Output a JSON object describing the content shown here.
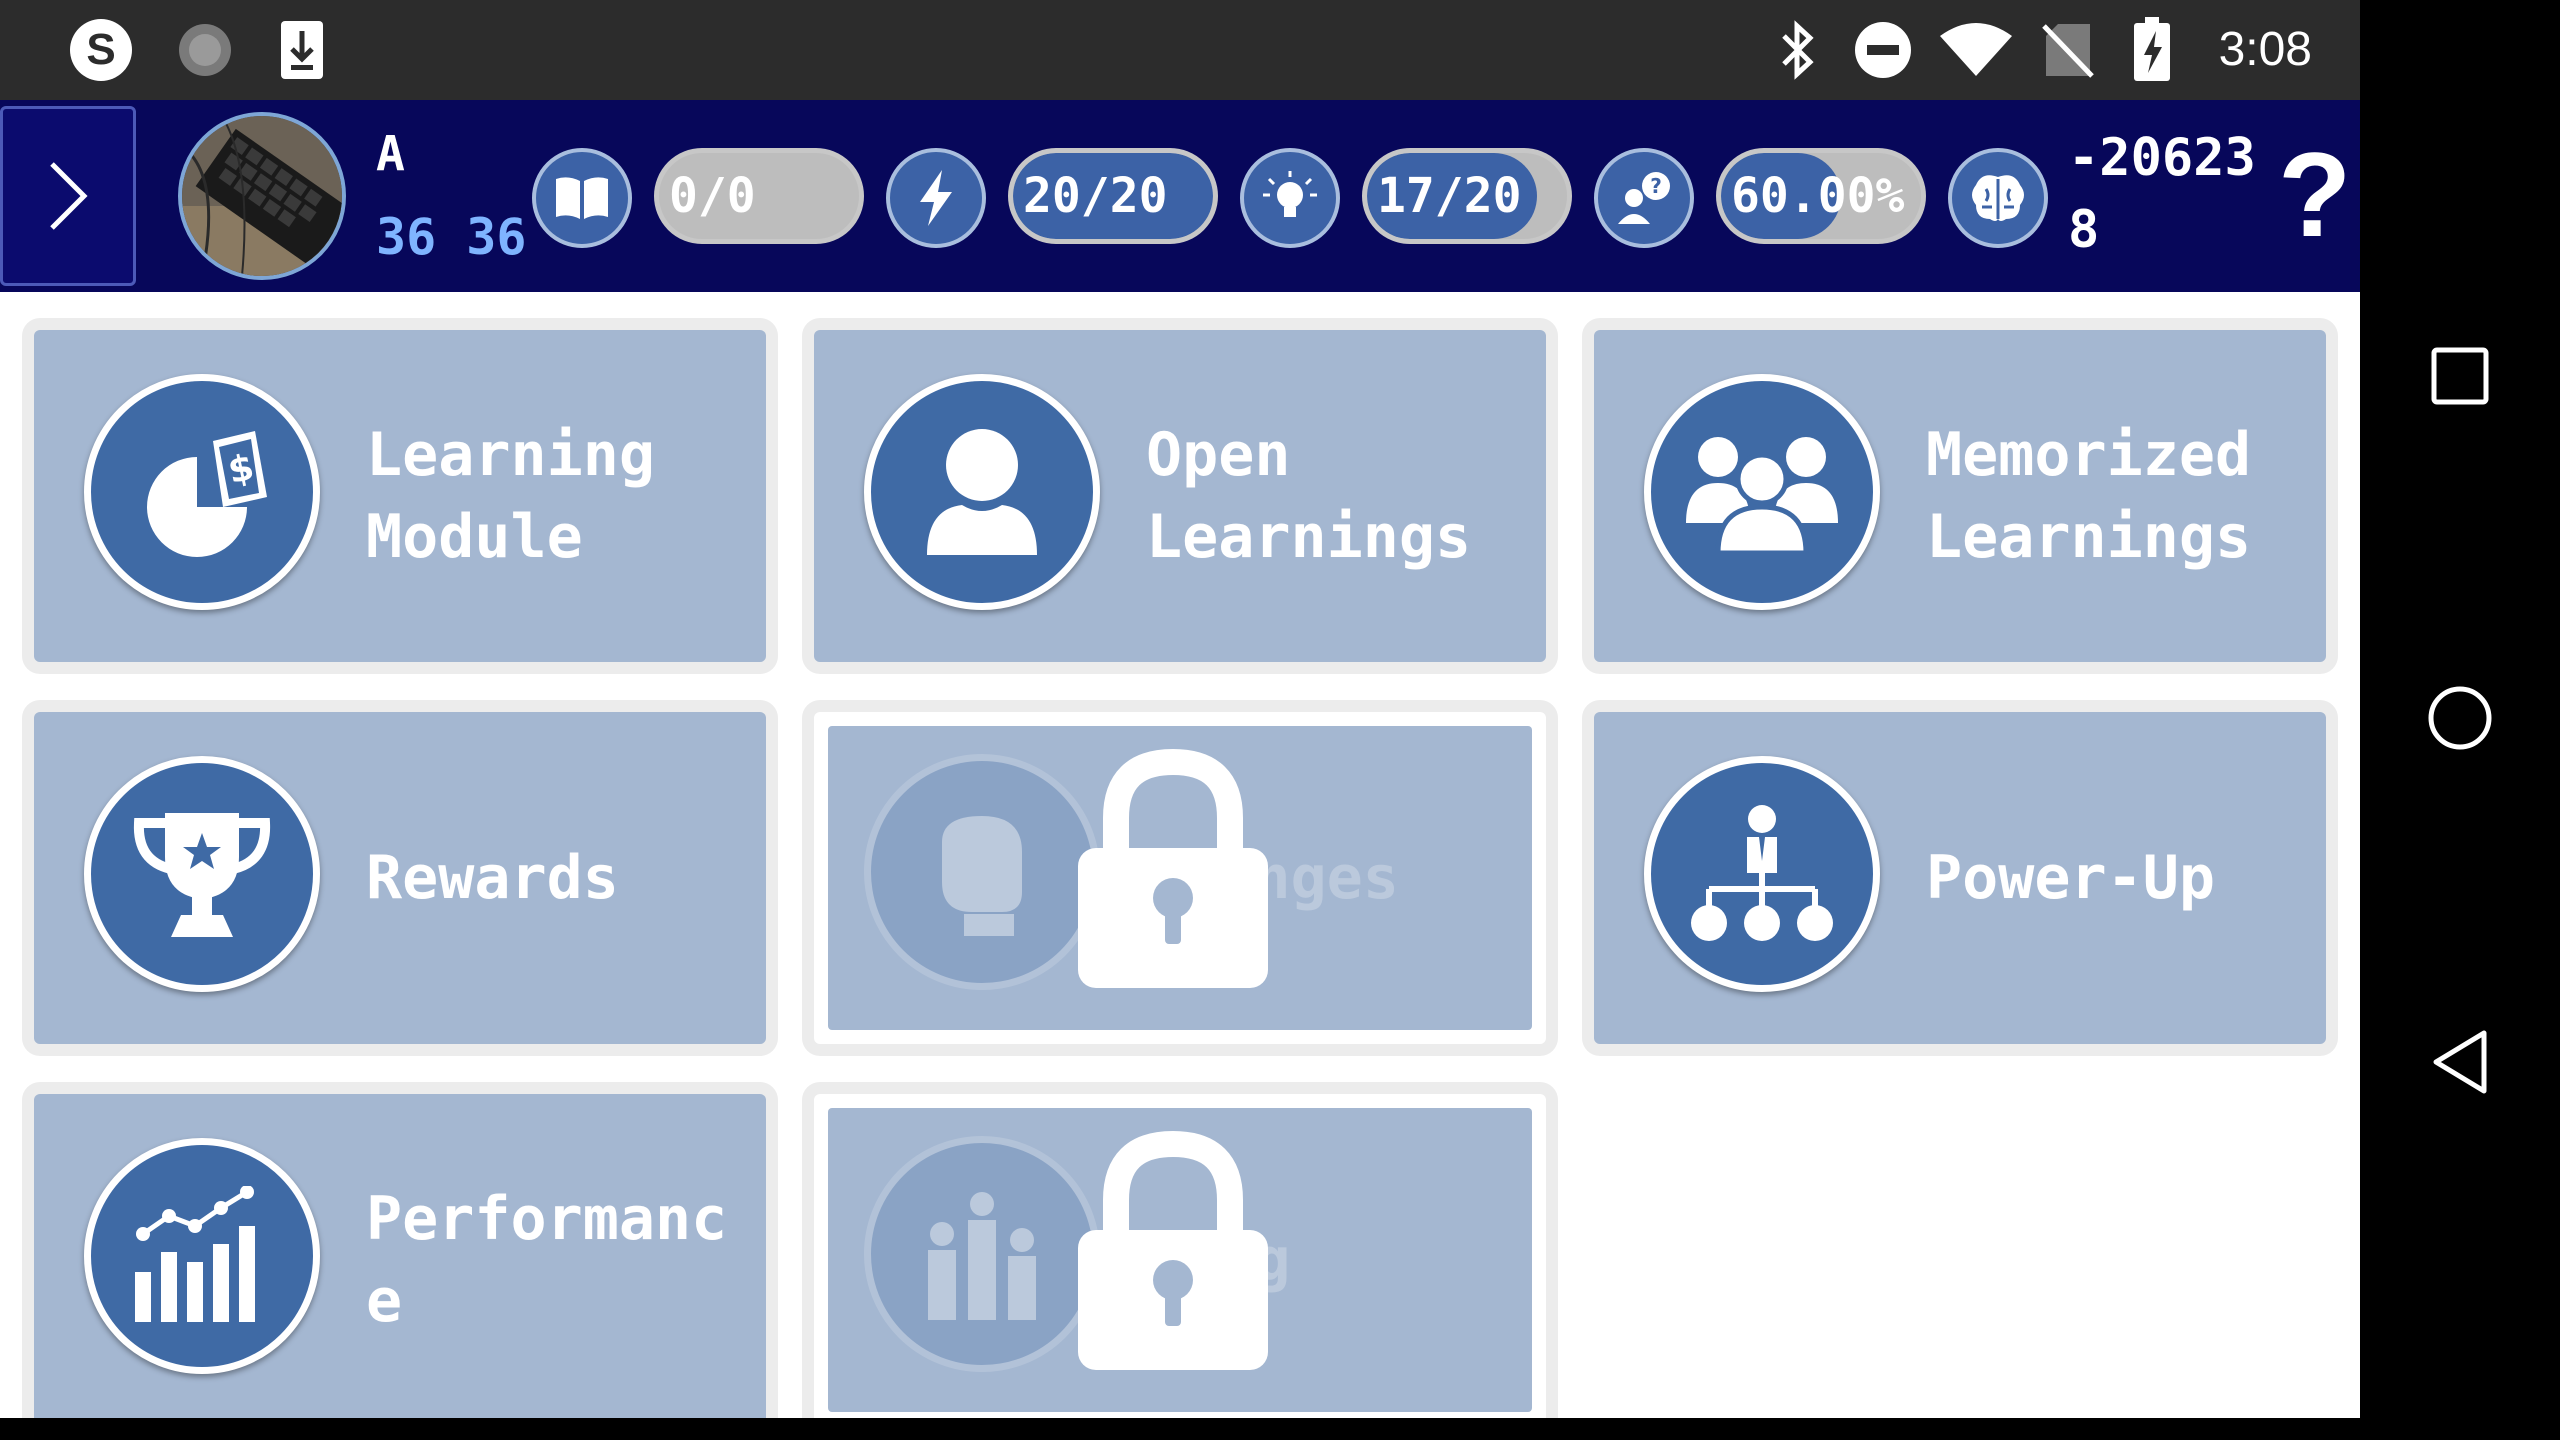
{
  "status_bar": {
    "time": "3:08",
    "left_icons": [
      "skype-icon",
      "loading-icon",
      "download-icon"
    ],
    "right_icons": [
      "bluetooth-icon",
      "do-not-disturb-icon",
      "wifi-icon",
      "no-sim-icon",
      "battery-charging-icon"
    ]
  },
  "header": {
    "user_name": "A",
    "user_level": "36 36",
    "stats": [
      {
        "icon": "book-icon",
        "text": "0/0",
        "fill": 0
      },
      {
        "icon": "lightning-icon",
        "text": "20/20",
        "fill": 1.0
      },
      {
        "icon": "lightbulb-icon",
        "text": "17/20",
        "fill": 0.85
      },
      {
        "icon": "user-question-icon",
        "text": "60.00%",
        "fill": 0.6
      }
    ],
    "score_line1": "-20623",
    "score_line2": "8",
    "help_label": "?"
  },
  "tiles": [
    {
      "label_line1": "Learning",
      "label_line2": "Module",
      "icon": "pie-chart-dollar-icon",
      "locked": false
    },
    {
      "label_line1": "Open",
      "label_line2": "Learnings",
      "icon": "person-icon",
      "locked": false
    },
    {
      "label_line1": "Memorized",
      "label_line2": "Learnings",
      "icon": "group-icon",
      "locked": false
    },
    {
      "label_line1": "Rewards",
      "label_line2": "",
      "icon": "trophy-icon",
      "locked": false
    },
    {
      "label_line1": "llenges",
      "label_line2": "",
      "icon": "boxing-glove-icon",
      "locked": true
    },
    {
      "label_line1": "Power-Up",
      "label_line2": "",
      "icon": "org-chart-icon",
      "locked": false
    },
    {
      "label_line1": "Performanc",
      "label_line2": "e",
      "icon": "growth-chart-icon",
      "locked": false
    },
    {
      "label_line1": "king",
      "label_line2": "",
      "icon": "podium-icon",
      "locked": true
    }
  ],
  "nav_bar": [
    "recents-icon",
    "home-icon",
    "back-icon"
  ],
  "colors": {
    "header_bg": "#07075a",
    "accent": "#3f6aa5",
    "tile_bg": "#a4b7d1",
    "level_text": "#7fb4ff"
  }
}
